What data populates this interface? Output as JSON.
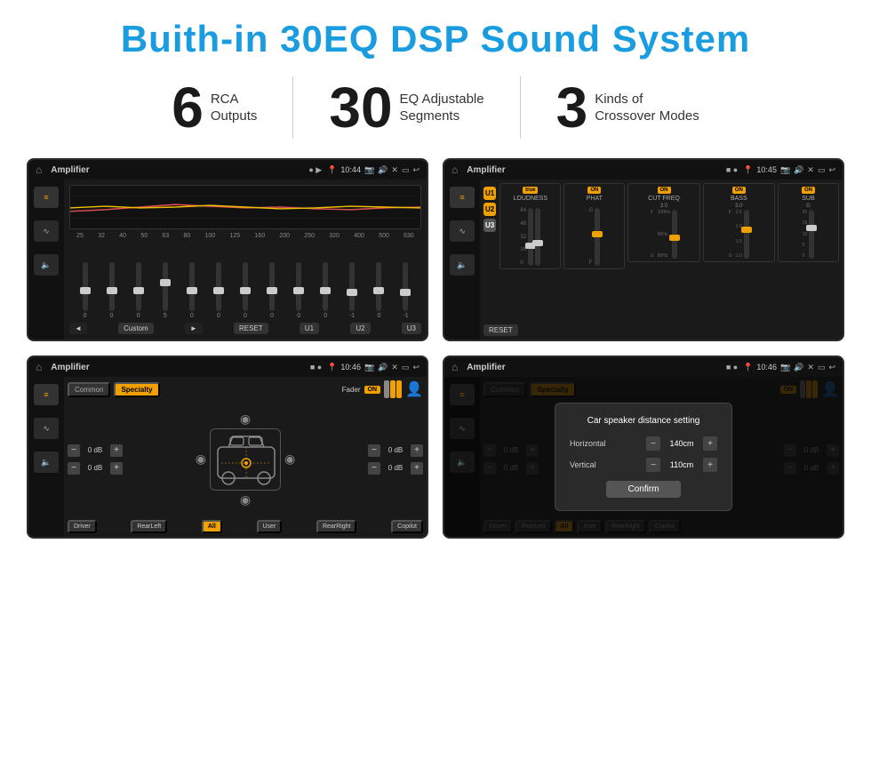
{
  "title": "Buith-in 30EQ DSP Sound System",
  "stats": [
    {
      "number": "6",
      "text_line1": "RCA",
      "text_line2": "Outputs"
    },
    {
      "number": "30",
      "text_line1": "EQ Adjustable",
      "text_line2": "Segments"
    },
    {
      "number": "3",
      "text_line1": "Kinds of",
      "text_line2": "Crossover Modes"
    }
  ],
  "screens": [
    {
      "id": "screen1",
      "bar": {
        "title": "Amplifier",
        "time": "10:44"
      },
      "type": "eq"
    },
    {
      "id": "screen2",
      "bar": {
        "title": "Amplifier",
        "time": "10:45"
      },
      "type": "amp"
    },
    {
      "id": "screen3",
      "bar": {
        "title": "Amplifier",
        "time": "10:46"
      },
      "type": "crossover"
    },
    {
      "id": "screen4",
      "bar": {
        "title": "Amplifier",
        "time": "10:46"
      },
      "type": "crossover-dialog"
    }
  ],
  "eq": {
    "frequencies": [
      "25",
      "32",
      "40",
      "50",
      "63",
      "80",
      "100",
      "125",
      "160",
      "200",
      "250",
      "320",
      "400",
      "500",
      "630"
    ],
    "values": [
      "0",
      "0",
      "0",
      "5",
      "0",
      "0",
      "0",
      "0",
      "0",
      "0",
      "-1",
      "0",
      "-1"
    ],
    "buttons": [
      "Custom",
      "RESET",
      "U1",
      "U2",
      "U3"
    ]
  },
  "amp": {
    "presets": [
      "U1",
      "U2",
      "U3"
    ],
    "controls": [
      {
        "label": "LOUDNESS",
        "on": true
      },
      {
        "label": "PHAT",
        "on": true
      },
      {
        "label": "CUT FREQ",
        "on": true
      },
      {
        "label": "BASS",
        "on": true
      },
      {
        "label": "SUB",
        "on": true
      }
    ],
    "reset": "RESET"
  },
  "crossover": {
    "tabs": [
      "Common",
      "Specialty"
    ],
    "fader_label": "Fader",
    "on_label": "ON",
    "db_values": [
      "0 dB",
      "0 dB",
      "0 dB",
      "0 dB"
    ],
    "bottom_buttons": [
      "Driver",
      "RearLeft",
      "All",
      "User",
      "RearRight",
      "Copilot"
    ]
  },
  "dialog": {
    "title": "Car speaker distance setting",
    "horizontal_label": "Horizontal",
    "horizontal_value": "140cm",
    "vertical_label": "Vertical",
    "vertical_value": "110cm",
    "confirm_label": "Confirm",
    "db_right1": "0 dB",
    "db_right2": "0 dB"
  }
}
